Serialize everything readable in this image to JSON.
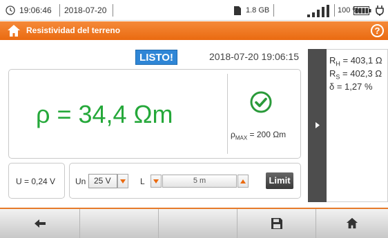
{
  "status": {
    "time": "19:06:46",
    "date": "2018-07-20",
    "storage": "1.8 GB",
    "battery_pct": "100 %"
  },
  "titlebar": {
    "title": "Resistividad del terreno",
    "help": "?"
  },
  "result": {
    "state": "LISTO!",
    "datetime": "2018-07-20 19:06:15",
    "main_value": "ρ = 34,4 Ωm",
    "pmax_symbol": "ρ",
    "pmax_sub": "MAX",
    "pmax_value": " = 200 Ωm"
  },
  "side": {
    "rh_sym": "R",
    "rh_sub": "H",
    "rh_val": " = 403,1 Ω",
    "rs_sym": "R",
    "rs_sub": "S",
    "rs_val": " = 402,3 Ω",
    "delta": "δ  = 1,27 %"
  },
  "controls": {
    "u_value": "U = 0,24 V",
    "un_label": "Un",
    "un_value": "25 V",
    "l_label": "L",
    "l_value": "5 m",
    "limit_label": "Limit"
  },
  "colors": {
    "accent": "#ea6a10",
    "ready_badge": "#2f86d6",
    "value_green": "#25a83a",
    "dark_strip": "#4d4d4d"
  },
  "icons": [
    "clock-icon",
    "sd-card-icon",
    "signal-icon",
    "battery-icon",
    "plug-icon",
    "home-icon",
    "help-icon",
    "check-icon",
    "expand-icon",
    "back-icon",
    "save-icon"
  ]
}
